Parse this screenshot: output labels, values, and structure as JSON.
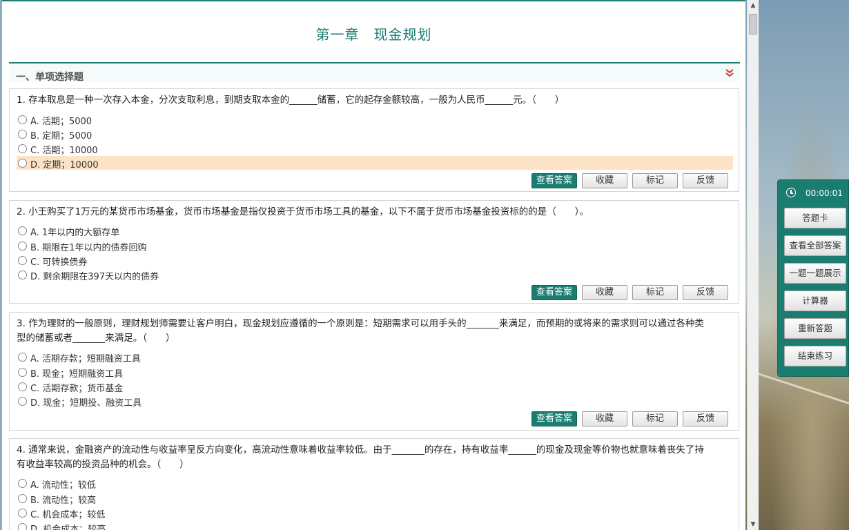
{
  "page_title": "第一章　现金规划",
  "section_title": "一、单项选择题",
  "question_buttons": {
    "view_answer": "查看答案",
    "favorite": "收藏",
    "mark": "标记",
    "feedback": "反馈"
  },
  "questions": [
    {
      "stem": "1. 存本取息是一种一次存入本金，分次支取利息，到期支取本金的______储蓄，它的起存金额较高，一般为人民币______元。（　　）",
      "options": [
        "A. 活期；5000",
        "B. 定期；5000",
        "C. 活期；10000",
        "D. 定期；10000"
      ],
      "highlighted_option": 3
    },
    {
      "stem": "2. 小王购买了1万元的某货币市场基金，货币市场基金是指仅投资于货币市场工具的基金，以下不属于货币市场基金投资标的的是（　　）。",
      "options": [
        "A. 1年以内的大额存单",
        "B. 期限在1年以内的债券回购",
        "C. 可转换债券",
        "D. 剩余期限在397天以内的债券"
      ]
    },
    {
      "stem_lines": [
        "3. 作为理财的一般原则，理财规划师需要让客户明白，现金规划应遵循的一个原则是：短期需求可以用手头的_______来满足，而预期的或将来的需求则可以通过各种类",
        "型的储蓄或者_______来满足。（　　）"
      ],
      "options": [
        "A. 活期存款；短期融资工具",
        "B. 现金；短期融资工具",
        "C. 活期存款；货币基金",
        "D. 现金；短期投、融资工具"
      ]
    },
    {
      "stem_lines": [
        "4. 通常来说，金融资产的流动性与收益率呈反方向变化，高流动性意味着收益率较低。由于_______的存在，持有收益率______的现金及现金等价物也就意味着丧失了持",
        "有收益率较高的投资品种的机会。（　　）"
      ],
      "options": [
        "A. 流动性；较低",
        "B. 流动性；较高",
        "C. 机会成本；较低",
        "D. 机会成本；较高"
      ]
    }
  ],
  "side_panel": {
    "timer": "00:00:01",
    "buttons": [
      "答题卡",
      "查看全部答案",
      "一题一题展示",
      "计算器",
      "重新答题",
      "结束练习"
    ]
  },
  "icons": {
    "clock": "clock-icon",
    "collapse": "double-chevron-down-icon",
    "scroll_up": "arrow-up-icon",
    "scroll_down": "arrow-down-icon"
  },
  "colors": {
    "accent": "#1a7d70",
    "highlight": "#fde3c6",
    "collapse_icon": "#c0392b"
  }
}
